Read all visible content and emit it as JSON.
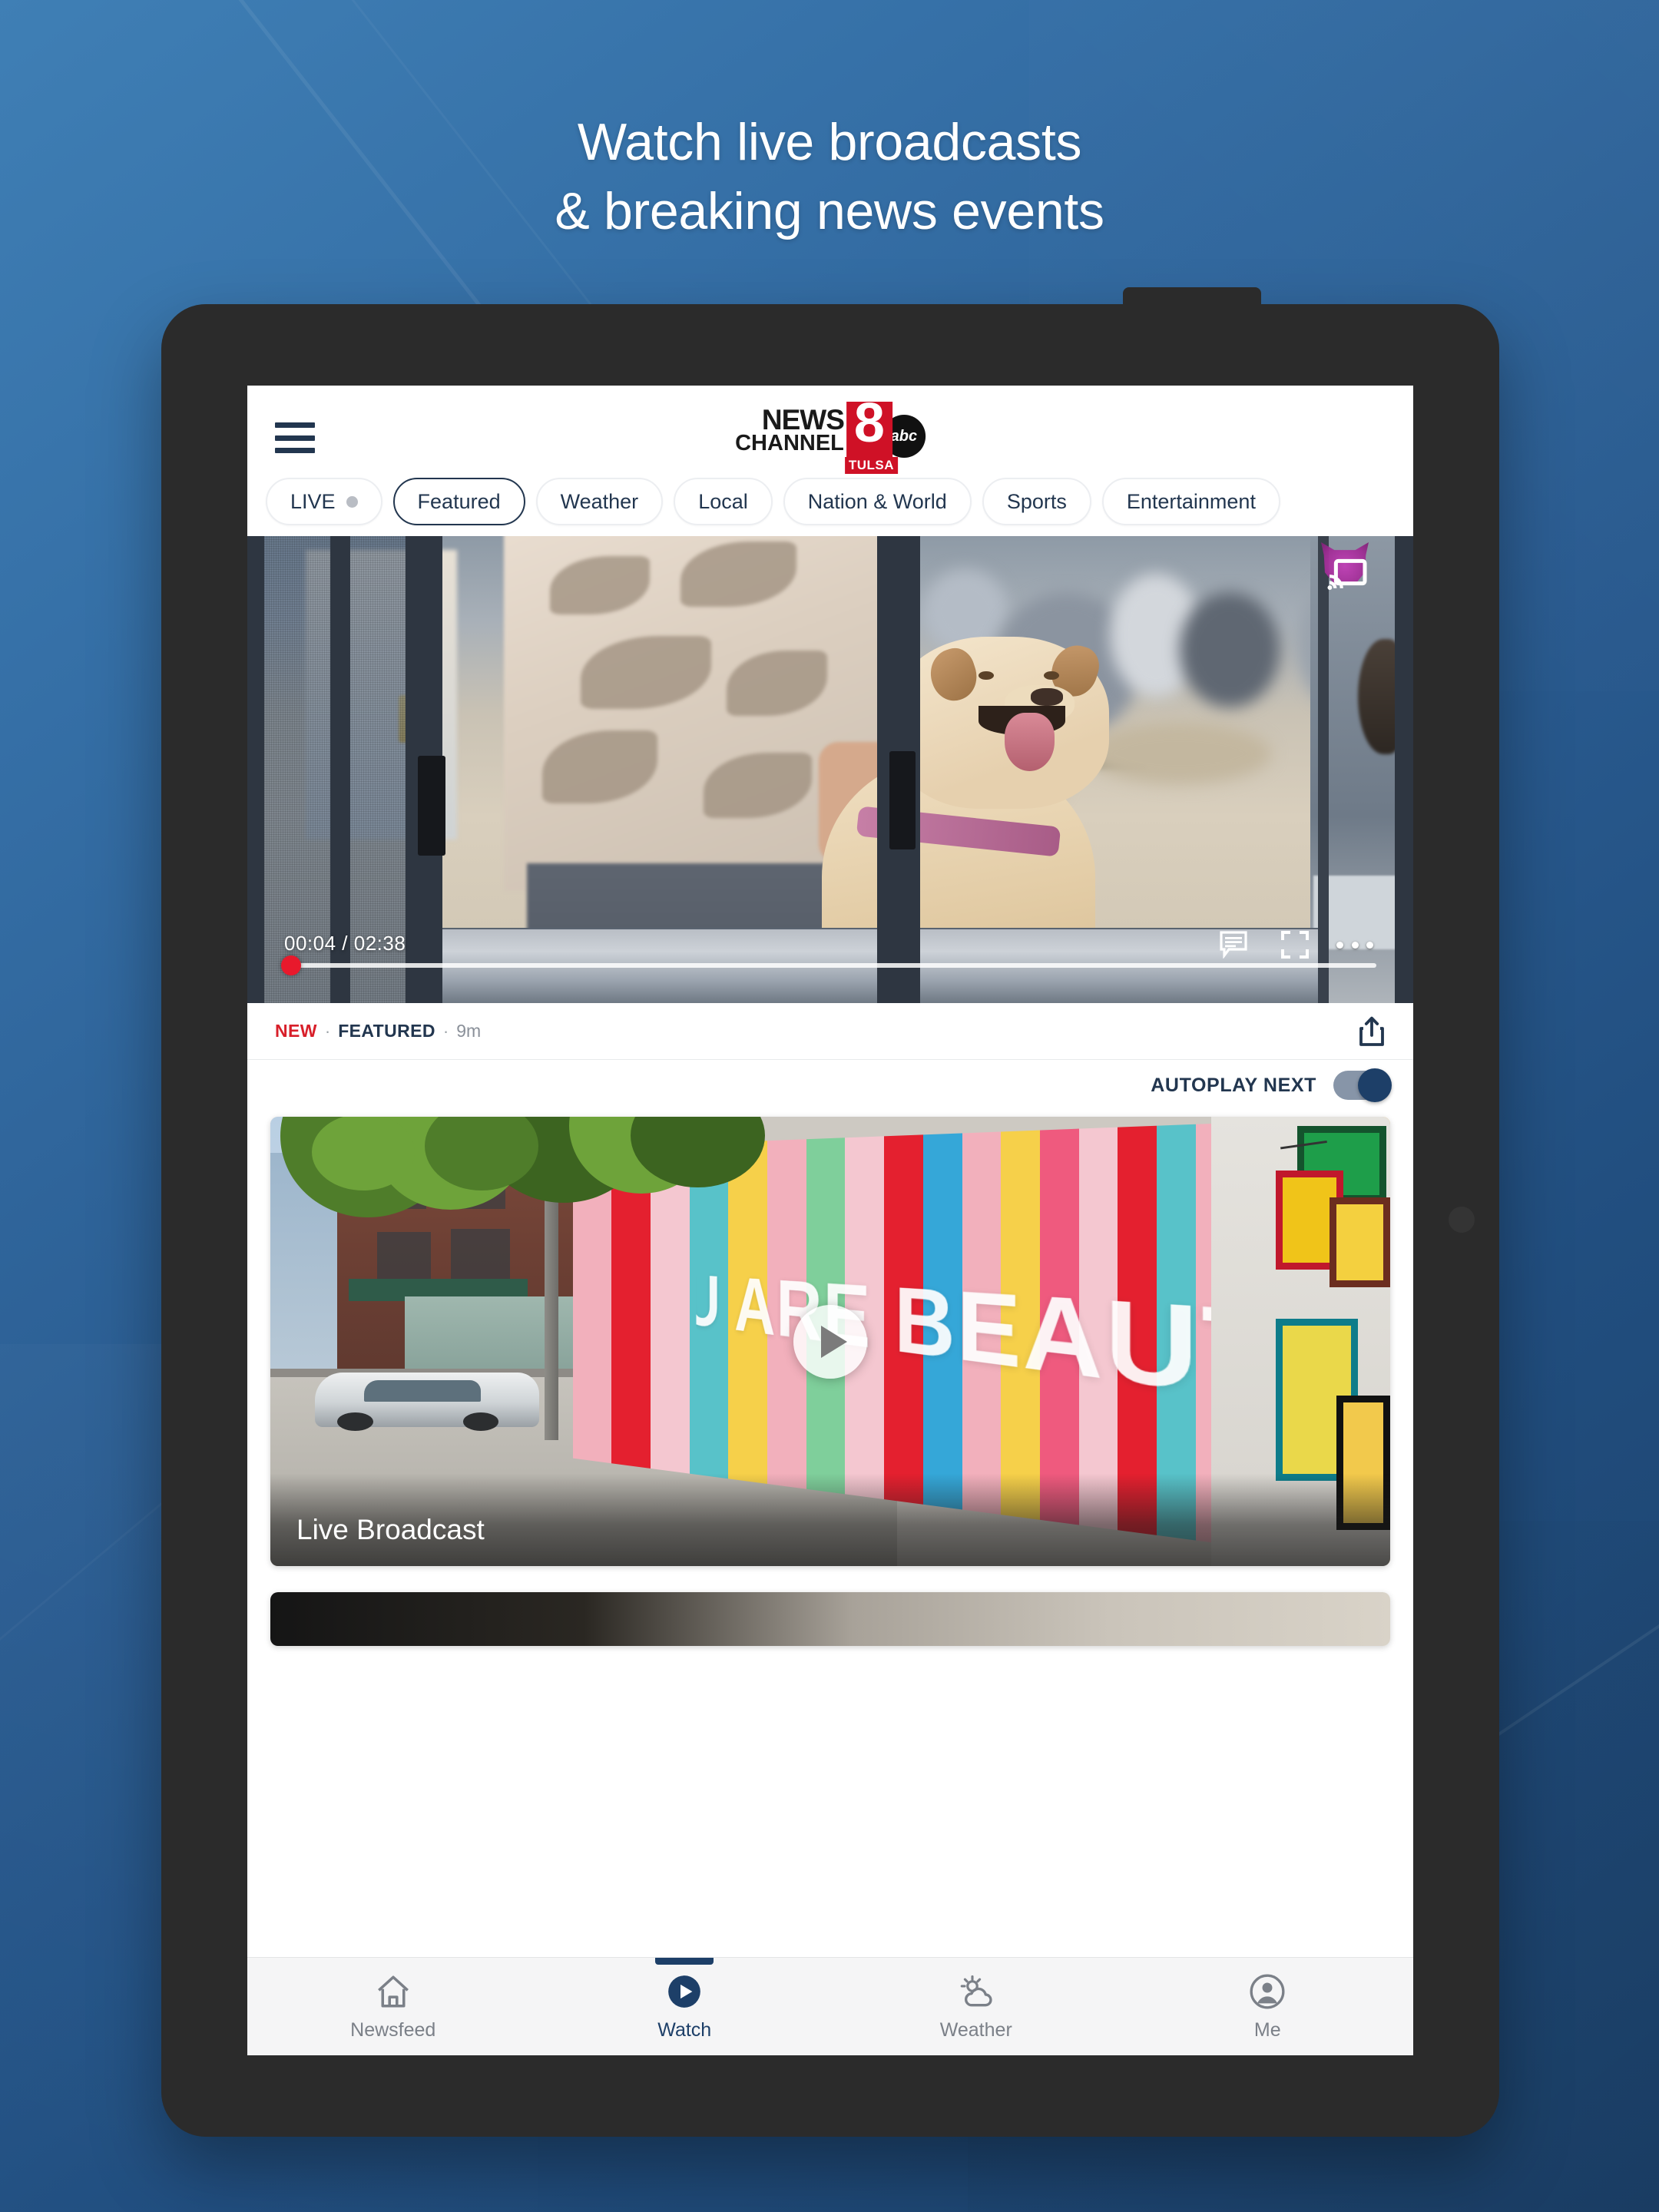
{
  "promo": {
    "headline_line1": "Watch live broadcasts",
    "headline_line2": "& breaking news events",
    "bg_color_top": "#3f7fb5",
    "bg_color_bottom": "#1b3f67"
  },
  "app": {
    "brand": {
      "word1": "NEWS",
      "word2": "CHANNEL",
      "channel_number": "8",
      "network": "abc",
      "market": "TULSA",
      "red": "#cf1126",
      "navy": "#22364f"
    },
    "menu_icon": "hamburger-icon",
    "chips": [
      {
        "label": "LIVE",
        "selected": false,
        "has_dot": true
      },
      {
        "label": "Featured",
        "selected": true,
        "has_dot": false
      },
      {
        "label": "Weather",
        "selected": false,
        "has_dot": false
      },
      {
        "label": "Local",
        "selected": false,
        "has_dot": false
      },
      {
        "label": "Nation & World",
        "selected": false,
        "has_dot": false
      },
      {
        "label": "Sports",
        "selected": false,
        "has_dot": false
      },
      {
        "label": "Entertainment",
        "selected": false,
        "has_dot": false
      }
    ],
    "player": {
      "current_time": "00:04",
      "separator": "/",
      "total_time": "02:38",
      "time_display": "00:04 / 02:38",
      "progress_percent": 3,
      "scrubber_color": "#e8192c",
      "cast_icon": "chromecast-icon",
      "cc_icon": "closed-caption-icon",
      "fullscreen_icon": "fullscreen-icon",
      "more_icon": "more-options-icon"
    },
    "meta": {
      "badge_new": "NEW",
      "badge_featured": "FEATURED",
      "dot": "·",
      "timestamp": "9m",
      "share_icon": "share-icon",
      "new_color": "#d81f2a"
    },
    "autoplay": {
      "label": "AUTOPLAY NEXT",
      "enabled": true
    },
    "feed": {
      "cards": [
        {
          "title": "Live Broadcast",
          "mural_text": "YOU ARE BEAUTIFUL",
          "play_icon": "play-circle-icon"
        },
        {
          "title": ""
        }
      ]
    },
    "bottom_nav": [
      {
        "label": "Newsfeed",
        "icon": "home-icon",
        "active": false
      },
      {
        "label": "Watch",
        "icon": "play-circle-icon",
        "active": true
      },
      {
        "label": "Weather",
        "icon": "sun-cloud-icon",
        "active": false
      },
      {
        "label": "Me",
        "icon": "account-icon",
        "active": false
      }
    ]
  }
}
